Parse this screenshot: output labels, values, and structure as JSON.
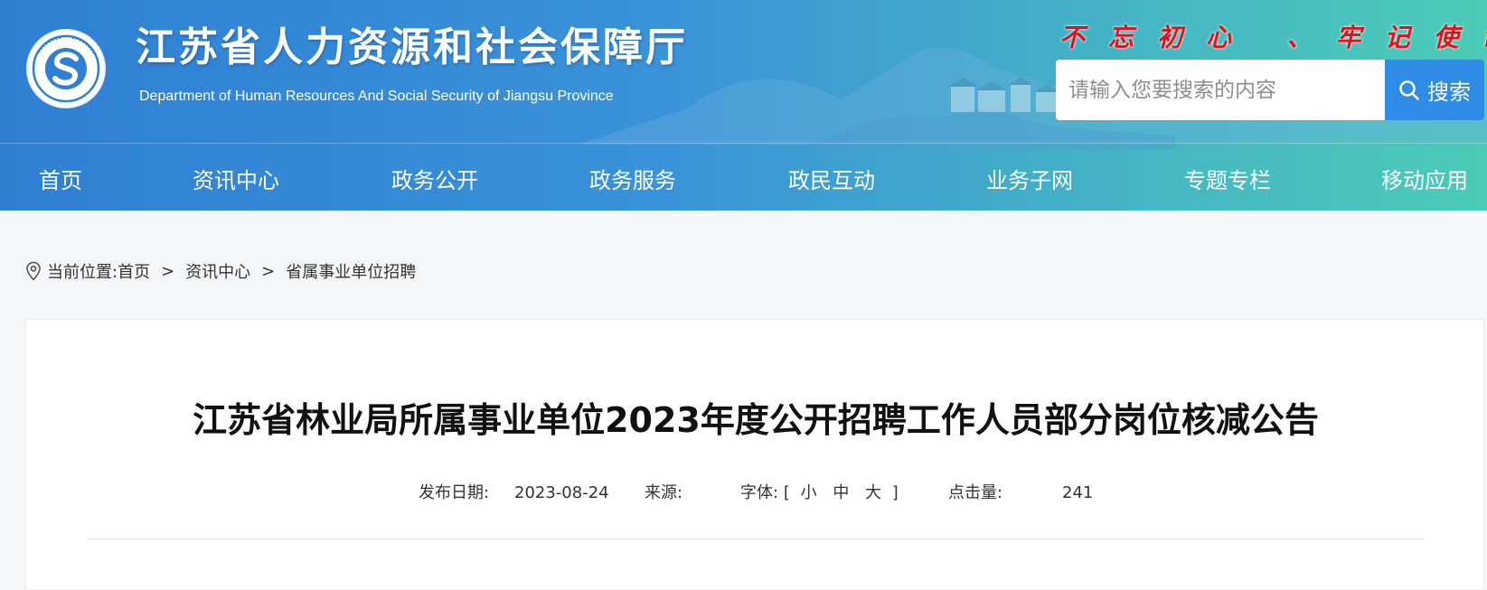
{
  "header": {
    "site_title": "江苏省人力资源和社会保障厅",
    "site_subtitle": "Department of Human Resources And Social Security of Jiangsu Province",
    "slogan": "不忘初心 、牢记使命",
    "search": {
      "placeholder": "请输入您要搜索的内容",
      "button_label": "搜索"
    },
    "brand_color": "#2f7fd3"
  },
  "nav": {
    "items": [
      "首页",
      "资讯中心",
      "政务公开",
      "政务服务",
      "政民互动",
      "业务子网",
      "专题专栏",
      "移动应用"
    ]
  },
  "breadcrumb": {
    "prefix": "当前位置:",
    "items": [
      "首页",
      "资讯中心",
      "省属事业单位招聘"
    ],
    "separator": ">"
  },
  "article": {
    "title": "江苏省林业局所属事业单位2023年度公开招聘工作人员部分岗位核减公告",
    "publish_date_label": "发布日期:",
    "publish_date": "2023-08-24",
    "source_label": "来源:",
    "font_label": "字体:",
    "font_bracket_open": "[",
    "font_options": [
      "小",
      "中",
      "大"
    ],
    "font_bracket_close": "]",
    "views_label": "点击量:",
    "views": "241"
  }
}
